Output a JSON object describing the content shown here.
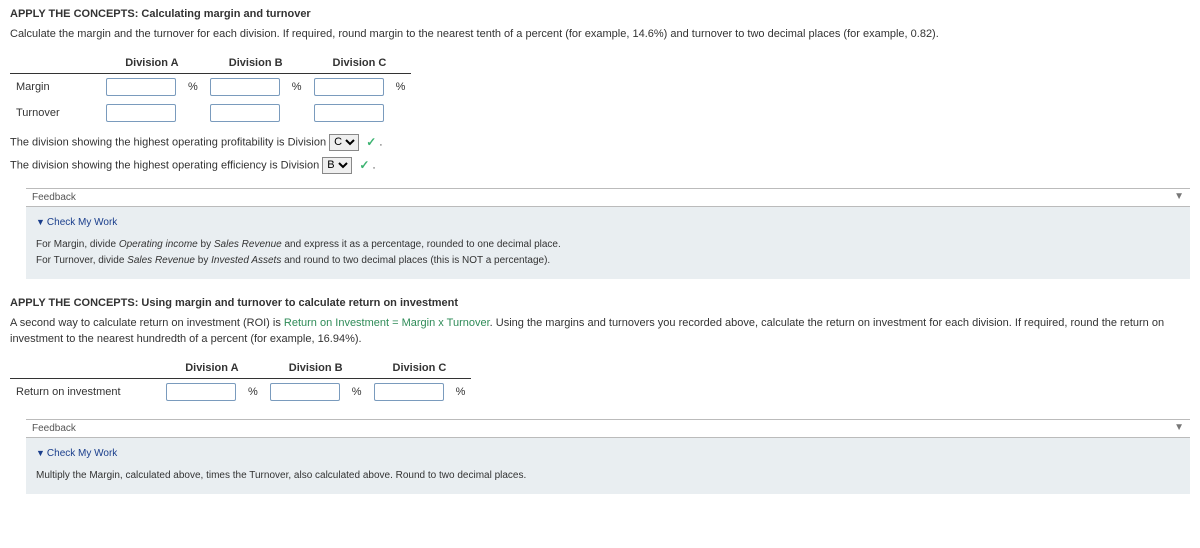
{
  "sec1": {
    "title": "APPLY THE CONCEPTS: Calculating margin and turnover",
    "instr": "Calculate the margin and the turnover for each division. If required, round margin to the nearest tenth of a percent (for example, 14.6%) and turnover to two decimal places (for example, 0.82).",
    "cols": {
      "a": "Division A",
      "b": "Division B",
      "c": "Division C"
    },
    "rows": {
      "margin": "Margin",
      "turnover": "Turnover"
    },
    "pct": "%",
    "sentence1_pre": "The division showing the highest operating profitability is Division ",
    "sentence1_sel": "C",
    "sentence2_pre": "The division showing the highest operating efficiency is Division ",
    "sentence2_sel": "B",
    "period": "."
  },
  "fb1": {
    "header": "Feedback",
    "cmw": "Check My Work",
    "line1_pre": "For Margin, divide ",
    "line1_em1": "Operating income",
    "line1_mid": " by ",
    "line1_em2": "Sales Revenue",
    "line1_post": " and express it as a percentage, rounded to one decimal place.",
    "line2_pre": "For Turnover, divide ",
    "line2_em1": "Sales Revenue",
    "line2_mid": " by ",
    "line2_em2": "Invested Assets",
    "line2_post": " and round to two decimal places (this is NOT a percentage)."
  },
  "sec2": {
    "title": "APPLY THE CONCEPTS: Using margin and turnover to calculate return on investment",
    "instr_pre": "A second way to calculate return on investment (ROI) is ",
    "instr_green": "Return on Investment = Margin x Turnover",
    "instr_post": ". Using the margins and turnovers you recorded above, calculate the return on investment for each division. If required, round the return on investment to the nearest hundredth of a percent (for example, 16.94%).",
    "cols": {
      "a": "Division A",
      "b": "Division B",
      "c": "Division C"
    },
    "row": "Return on investment",
    "pct": "%"
  },
  "fb2": {
    "header": "Feedback",
    "cmw": "Check My Work",
    "line": "Multiply the Margin, calculated above, times the Turnover, also calculated above. Round to two decimal places."
  }
}
